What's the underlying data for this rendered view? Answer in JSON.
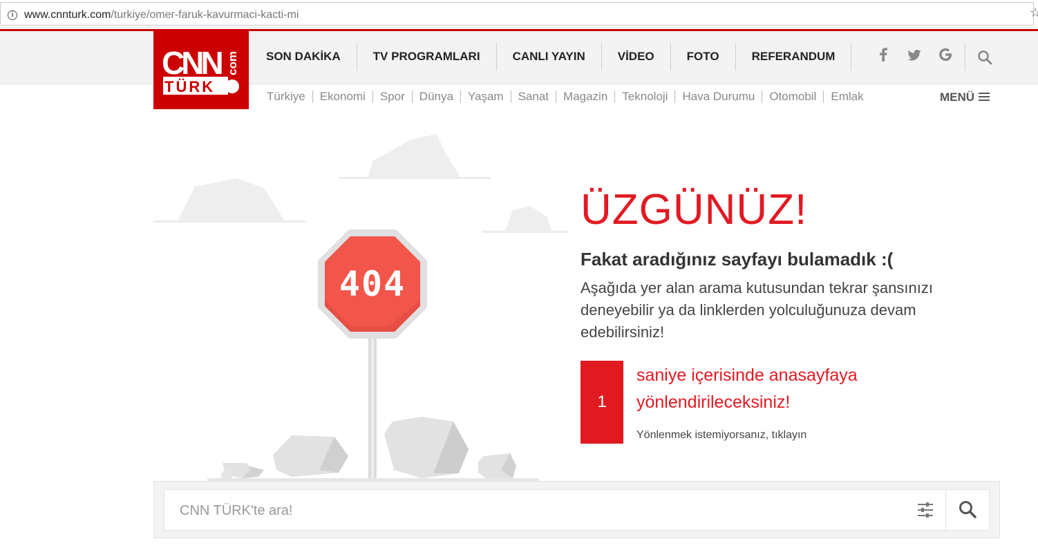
{
  "browser": {
    "url_host": "www.cnnturk.com",
    "url_path": "/turkiye/omer-faruk-kavurmaci-kacti-mi"
  },
  "logo": {
    "line1": "CNN",
    "line2": "TÜRK",
    "suffix": "com"
  },
  "main_nav": [
    "SON DAKİKA",
    "TV PROGRAMLARI",
    "CANLI YAYIN",
    "VİDEO",
    "FOTO",
    "REFERANDUM"
  ],
  "social_icons": [
    "facebook-icon",
    "twitter-icon",
    "google-icon"
  ],
  "sub_nav": [
    "Türkiye",
    "Ekonomi",
    "Spor",
    "Dünya",
    "Yaşam",
    "Sanat",
    "Magazin",
    "Teknoloji",
    "Hava Durumu",
    "Otomobil",
    "Emlak"
  ],
  "menu_label": "MENÜ",
  "error": {
    "sign_text": "404",
    "title": "ÜZGÜNÜZ!",
    "subtitle": "Fakat aradığınız sayfayı bulamadık :(",
    "description": "Aşağıda yer alan arama kutusundan tekrar şansınızı deneyebilir ya da linklerden yolculuğunuza devam edebilirsiniz!",
    "countdown": "1",
    "redirect_text": "saniye içerisinde anasayfaya yönlendirileceksiniz!",
    "cancel_link": "Yönlenmek istemiyorsanız, tıklayın"
  },
  "search": {
    "placeholder": "CNN TÜRK'te ara!"
  },
  "colors": {
    "brand_red": "#cc0000",
    "accent_red": "#e11a22",
    "sign_red": "#f2554a"
  }
}
